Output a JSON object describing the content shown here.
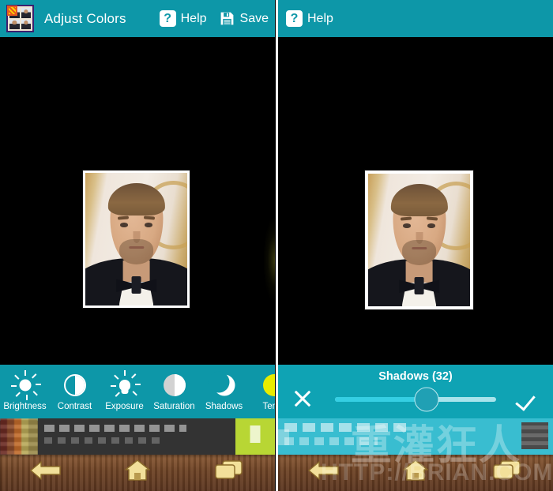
{
  "left_panel": {
    "appbar": {
      "app_icon_name": "passport-photo-grid-icon",
      "title": "Adjust Colors",
      "help_label": "Help",
      "help_icon": "question-mark-icon",
      "save_label": "Save",
      "save_icon": "floppy-disk-icon",
      "background_color": "#0d97a8"
    },
    "adjust_toolbar": {
      "items": [
        {
          "label": "Brightness",
          "icon": "sun-icon"
        },
        {
          "label": "Contrast",
          "icon": "contrast-half-circle-icon"
        },
        {
          "label": "Exposure",
          "icon": "exposure-bulb-icon"
        },
        {
          "label": "Saturation",
          "icon": "saturation-half-circle-icon"
        },
        {
          "label": "Shadows",
          "icon": "crescent-moon-icon"
        },
        {
          "label": "Temp",
          "icon": "temperature-yellow-circle-icon"
        }
      ]
    },
    "photo": {
      "subject": "portrait-photo-man-in-tuxedo-bowtie"
    },
    "ad_banner": {
      "name": "advertisement-banner"
    },
    "navbar": {
      "back_icon": "back-arrow-icon",
      "home_icon": "home-icon",
      "recents_icon": "recent-apps-icon"
    }
  },
  "right_panel": {
    "appbar": {
      "help_label": "Help",
      "help_icon": "question-mark-icon",
      "background_color": "#0d97a8"
    },
    "photo": {
      "subject": "portrait-photo-man-in-tuxedo-bowtie"
    },
    "slider": {
      "title": "Shadows (32)",
      "adjustment_name": "Shadows",
      "value": 32,
      "fill_percent": 57,
      "cancel_icon": "close-x-icon",
      "confirm_icon": "checkmark-icon",
      "track_color": "#a8e4ec",
      "fill_color": "#35cfe3",
      "thumb_color": "#20a0b4"
    },
    "ad_banner": {
      "name": "advertisement-banner"
    },
    "watermark": {
      "cjk_text": "重灌狂人",
      "url_text": "HTTP://BRIAN.COM"
    },
    "navbar": {
      "back_icon": "back-arrow-icon",
      "home_icon": "home-icon",
      "recents_icon": "recent-apps-icon"
    }
  },
  "theme": {
    "teal": "#0d97a8",
    "slider_teal": "#0fa3b4",
    "canvas_black": "#000000",
    "navbar_wood": "#6e4325",
    "accent_yellow": "#e8ec00"
  }
}
